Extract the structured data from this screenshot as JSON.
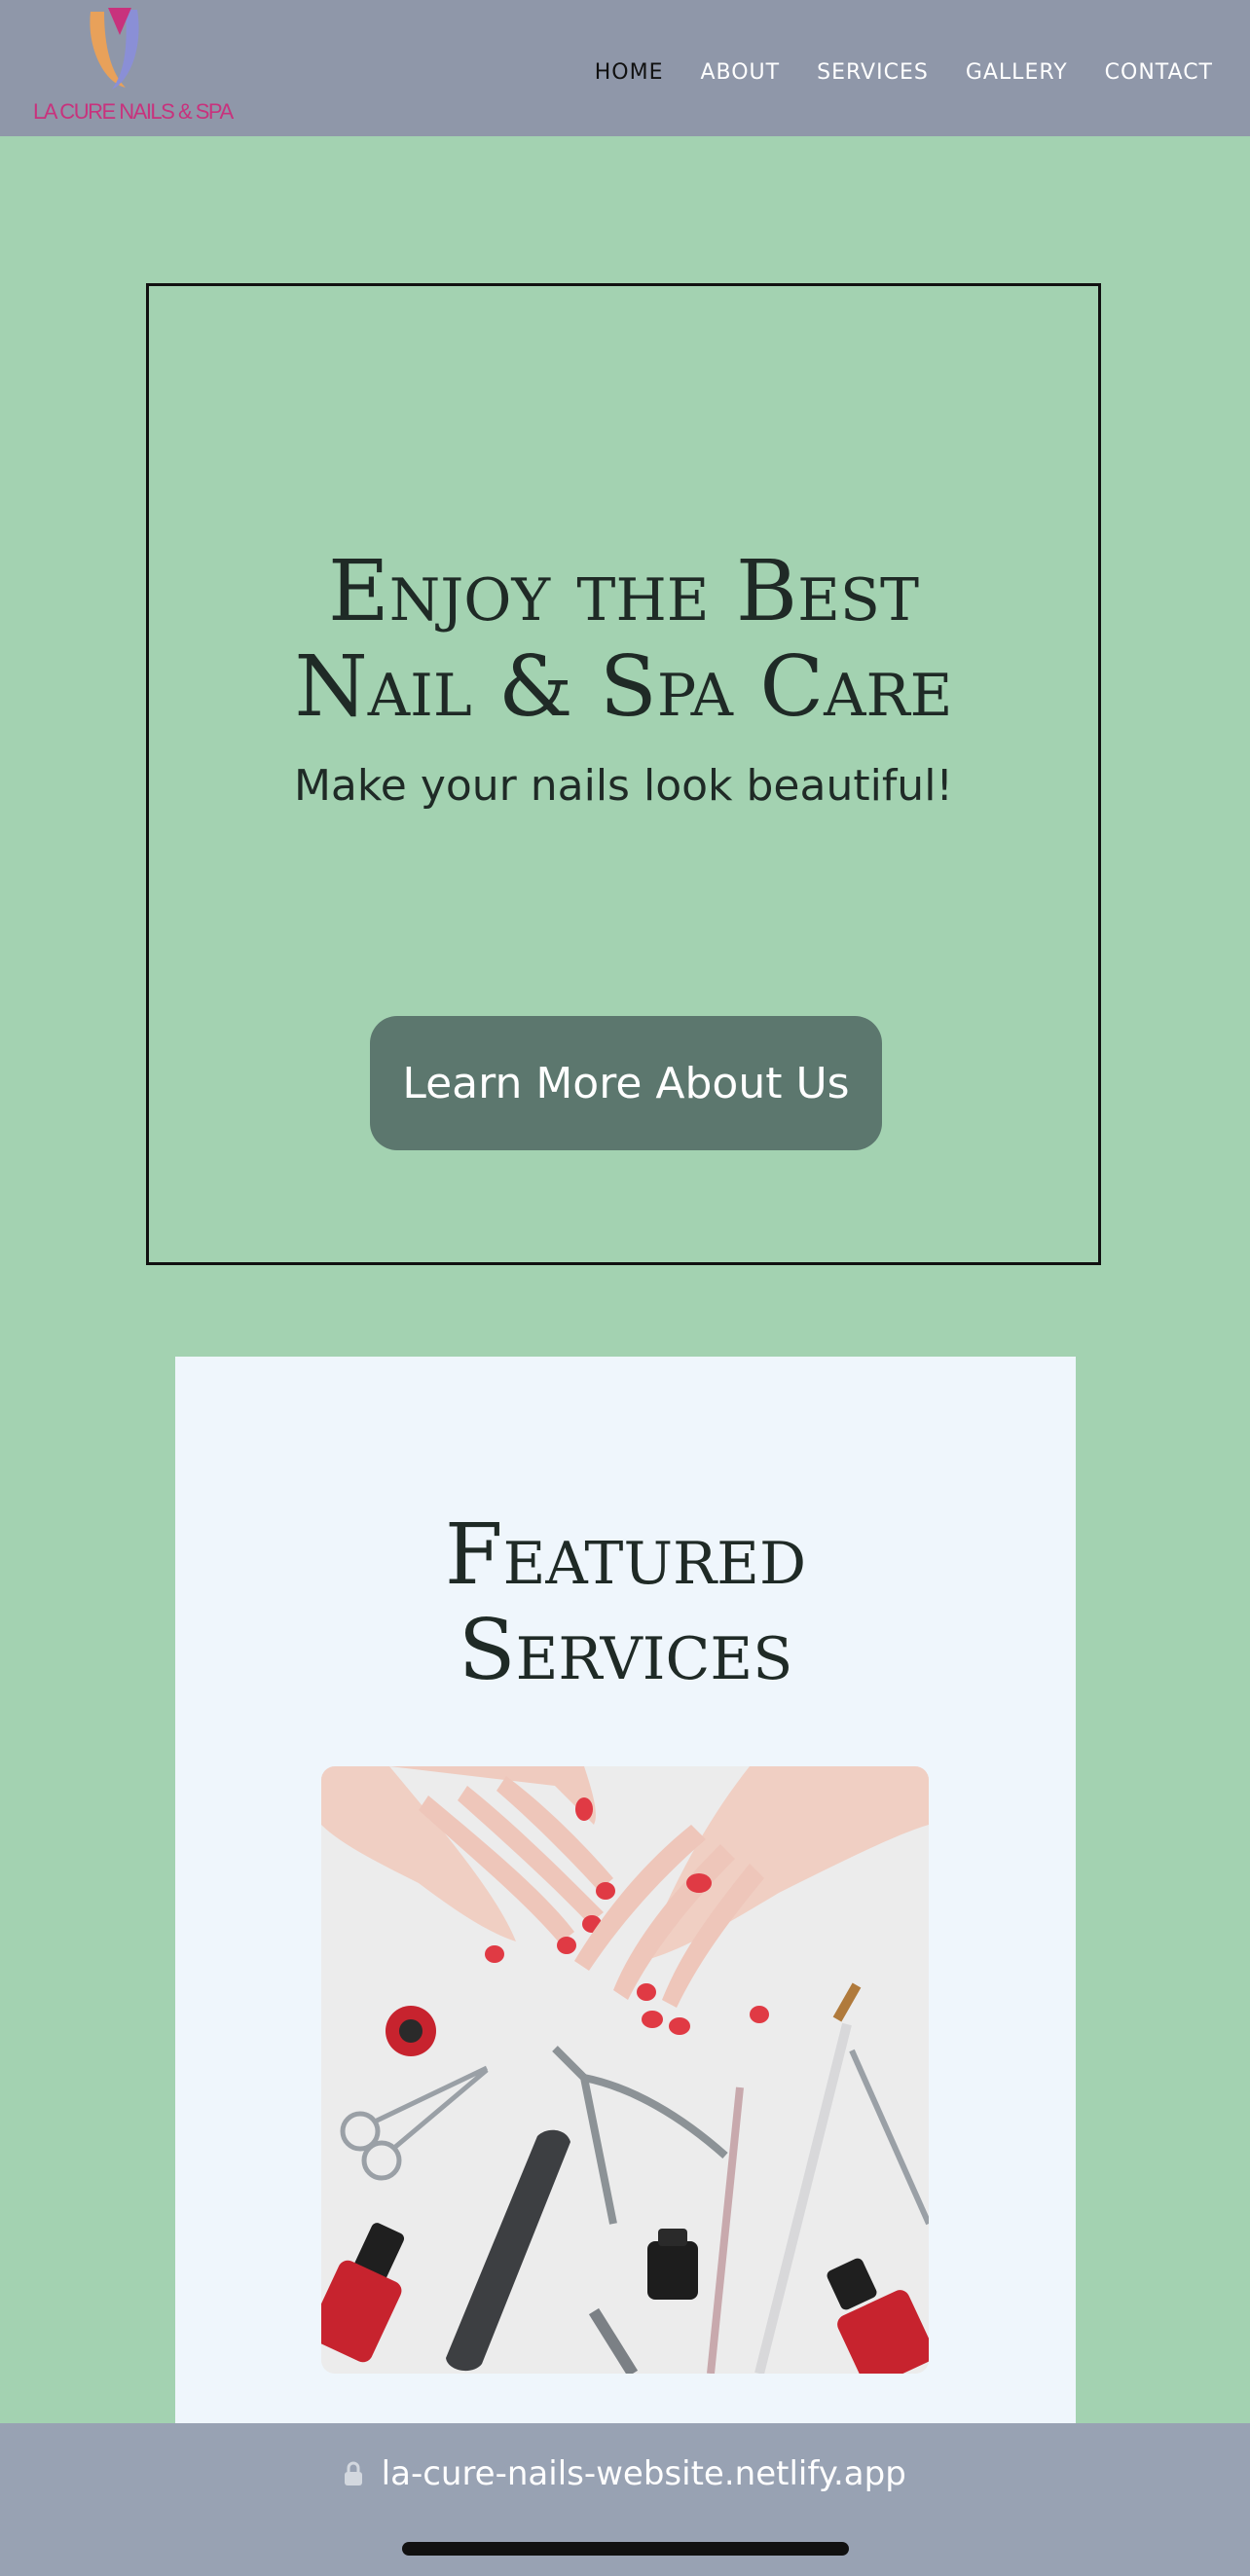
{
  "header": {
    "logo_text": "LA CURE NAILS & SPA",
    "nav": [
      {
        "label": "HOME",
        "active": true
      },
      {
        "label": "ABOUT"
      },
      {
        "label": "SERVICES"
      },
      {
        "label": "GALLERY"
      },
      {
        "label": "CONTACT"
      }
    ]
  },
  "hero": {
    "title_line1": "Enjoy the Best",
    "title_line2": "Nail & Spa Care",
    "subtitle": "Make your nails look beautiful!",
    "button_label": "Learn More About Us"
  },
  "featured": {
    "title_line1": "Featured",
    "title_line2": "Services",
    "image_icon": "manicure-tools-photo"
  },
  "browser": {
    "url": "la-cure-nails-website.netlify.app",
    "lock_icon": "lock-icon"
  },
  "colors": {
    "background": "#a3d2b1",
    "header": "#8f97a9",
    "button": "#5c776e",
    "card": "#eff6fc",
    "logo": "#c8327d",
    "url_bar": "#98a2b3"
  }
}
